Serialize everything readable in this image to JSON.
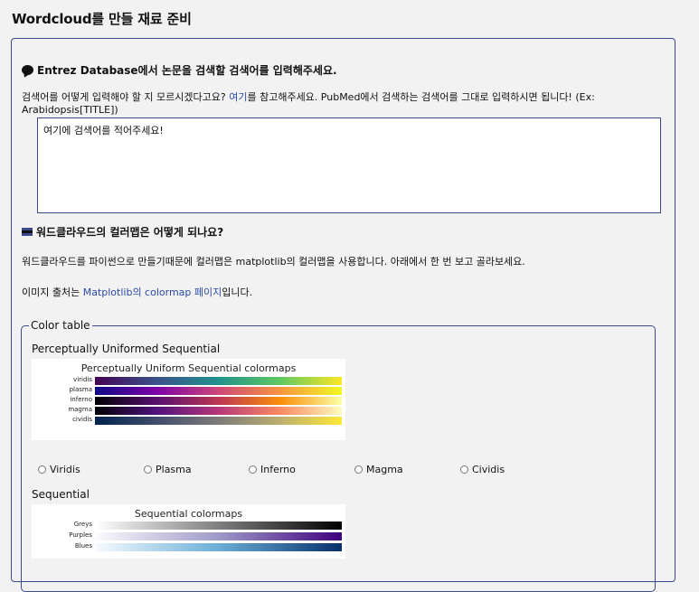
{
  "page_title": "Wordcloud를 만들 재료 준비",
  "search_section": {
    "title": "Entrez Database에서 논문을 검색할 검색어를 입력해주세요.",
    "help_prefix": "검색어를 어떻게 입력해야 할 지 모르시겠다고요? ",
    "help_link": "여기",
    "help_suffix": "를 참고해주세요. PubMed에서 검색하는 검색어를 그대로 입력하시면 됩니다! (Ex: Arabidopsis[TITLE])",
    "query_value": "여기에 검색어를 적어주세요!"
  },
  "colormap_section": {
    "title": "워드클라우드의 컬러맵은 어떻게 되나요?",
    "desc": "워드클라우드를 파이썬으로 만들기때문에 컬러맵은 matplotlib의 컬러맵을 사용합니다. 아래에서 한 번 보고 골라보세요.",
    "source_prefix": "이미지 출처는 ",
    "source_link": "Matplotlib의 colormap 페이지",
    "source_suffix": "입니다."
  },
  "color_table": {
    "legend": "Color table",
    "groups": [
      {
        "title": "Perceptually Uniformed Sequential",
        "chart_title": "Perceptually Uniform Sequential colormaps",
        "maps": [
          "viridis",
          "plasma",
          "inferno",
          "magma",
          "cividis"
        ]
      },
      {
        "title": "Sequential",
        "chart_title": "Sequential colormaps",
        "maps": [
          "Greys",
          "Purples",
          "Blues"
        ]
      }
    ],
    "options": [
      "Viridis",
      "Plasma",
      "Inferno",
      "Magma",
      "Cividis"
    ],
    "selected": ""
  },
  "colors": {
    "accent": "#3b4a8c",
    "link": "#2a4aa8",
    "background": "#f2f2f2"
  }
}
